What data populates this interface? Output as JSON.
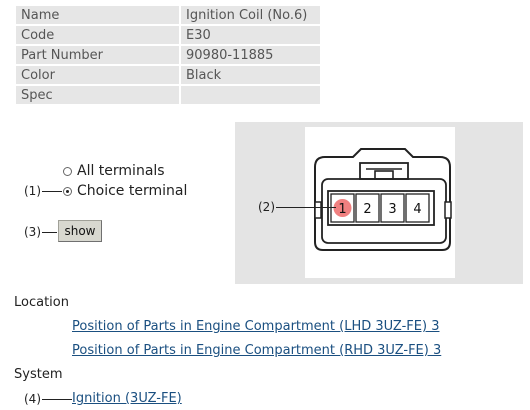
{
  "info": {
    "rows": [
      {
        "label": "Name",
        "value": "Ignition Coil (No.6)"
      },
      {
        "label": "Code",
        "value": "E30"
      },
      {
        "label": "Part Number",
        "value": "90980-11885"
      },
      {
        "label": "Color",
        "value": "Black"
      },
      {
        "label": "Spec",
        "value": ""
      }
    ]
  },
  "terminals": {
    "all_label": "All terminals",
    "choice_label": "Choice terminal",
    "selected": "choice"
  },
  "callouts": {
    "c1": "(1)",
    "c2": "(2)",
    "c3": "(3)",
    "c4": "(4)"
  },
  "show_button": "show",
  "connector": {
    "pins": [
      "1",
      "2",
      "3",
      "4"
    ],
    "highlighted_pin": "1",
    "highlight_color": "#f08080"
  },
  "location": {
    "heading": "Location",
    "links": [
      "Position of Parts in Engine Compartment (LHD 3UZ-FE) 3",
      "Position of Parts in Engine Compartment (RHD 3UZ-FE) 3"
    ]
  },
  "system": {
    "heading": "System",
    "links": [
      "Ignition (3UZ-FE)"
    ]
  }
}
